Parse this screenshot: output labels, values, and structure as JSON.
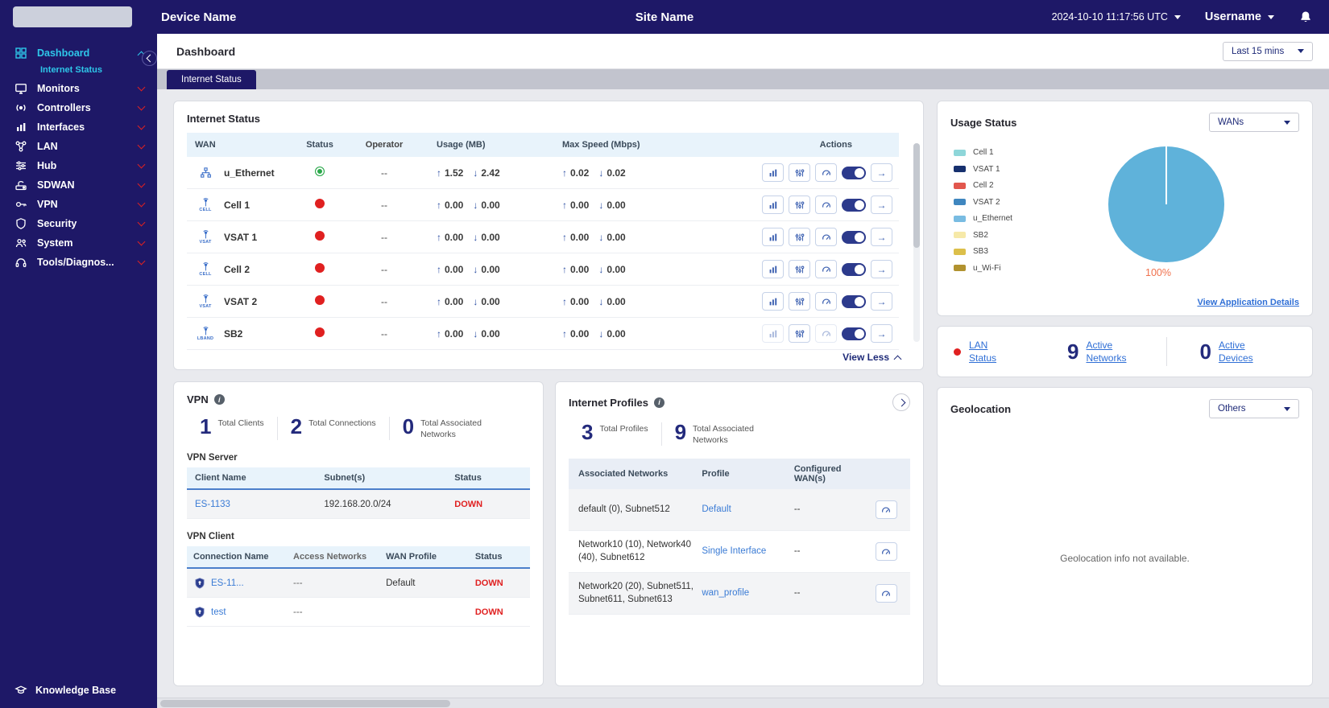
{
  "icons": {
    "up": "↑",
    "down": "↓",
    "info": "i",
    "arrow_right": "→"
  },
  "header": {
    "device_name": "Device Name",
    "site_name": "Site Name",
    "datetime": "2024-10-10 11:17:56 UTC",
    "username": "Username"
  },
  "sidebar": {
    "items": [
      "Dashboard",
      "Internet Status",
      "Monitors",
      "Controllers",
      "Interfaces",
      "LAN",
      "Hub",
      "SDWAN",
      "VPN",
      "Security",
      "System",
      "Tools/Diagnos..."
    ],
    "footer": "Knowledge Base"
  },
  "page": {
    "title": "Dashboard",
    "time_range": "Last 15 mins",
    "tab": "Internet Status"
  },
  "internet_status": {
    "title": "Internet Status",
    "columns": [
      "WAN",
      "Status",
      "Operator",
      "Usage (MB)",
      "Max Speed (Mbps)",
      "Actions"
    ],
    "rows": [
      {
        "name": "u_Ethernet",
        "caption": "",
        "is_ethernet": true,
        "up": true,
        "operator": "--",
        "usage_up": "1.52",
        "usage_down": "2.42",
        "speed_up": "0.02",
        "speed_down": "0.02"
      },
      {
        "name": "Cell 1",
        "caption": "CELL",
        "up": false,
        "operator": "--",
        "usage_up": "0.00",
        "usage_down": "0.00",
        "speed_up": "0.00",
        "speed_down": "0.00"
      },
      {
        "name": "VSAT 1",
        "caption": "VSAT",
        "up": false,
        "operator": "--",
        "usage_up": "0.00",
        "usage_down": "0.00",
        "speed_up": "0.00",
        "speed_down": "0.00"
      },
      {
        "name": "Cell 2",
        "caption": "CELL",
        "up": false,
        "operator": "--",
        "usage_up": "0.00",
        "usage_down": "0.00",
        "speed_up": "0.00",
        "speed_down": "0.00"
      },
      {
        "name": "VSAT 2",
        "caption": "VSAT",
        "up": false,
        "operator": "--",
        "usage_up": "0.00",
        "usage_down": "0.00",
        "speed_up": "0.00",
        "speed_down": "0.00"
      },
      {
        "name": "SB2",
        "caption": "LBAND",
        "up": false,
        "muted": true,
        "operator": "--",
        "usage_up": "0.00",
        "usage_down": "0.00",
        "speed_up": "0.00",
        "speed_down": "0.00"
      }
    ],
    "view_less": "View Less"
  },
  "usage_status": {
    "title": "Usage Status",
    "dropdown": "WANs",
    "legend": [
      {
        "label": "Cell 1",
        "color": "#8ed6d9"
      },
      {
        "label": "VSAT 1",
        "color": "#16306e"
      },
      {
        "label": "Cell 2",
        "color": "#e2574d"
      },
      {
        "label": "VSAT 2",
        "color": "#3f86bf"
      },
      {
        "label": "u_Ethernet",
        "color": "#79bce2"
      },
      {
        "label": "SB2",
        "color": "#f6e9a8"
      },
      {
        "label": "SB3",
        "color": "#dcbf4a"
      },
      {
        "label": "u_Wi-Fi",
        "color": "#b1922f"
      }
    ],
    "pie_color": "#5fb2da",
    "pie_label": "100%",
    "link": "View Application Details"
  },
  "lan_status": {
    "label": "LAN Status",
    "networks": "9",
    "networks_label": "Active Networks",
    "devices": "0",
    "devices_label": "Active Devices"
  },
  "vpn": {
    "title": "VPN",
    "stats": [
      {
        "value": "1",
        "label": "Total Clients"
      },
      {
        "value": "2",
        "label": "Total Connections"
      },
      {
        "value": "0",
        "label": "Total Associated Networks"
      }
    ],
    "server_title": "VPN Server",
    "server_cols": [
      "Client Name",
      "Subnet(s)",
      "Status"
    ],
    "server_rows": [
      {
        "name": "ES-1133",
        "subnets": "192.168.20.0/24",
        "status": "DOWN"
      }
    ],
    "client_title": "VPN Client",
    "client_cols": [
      "Connection Name",
      "Access Networks",
      "WAN Profile",
      "Status"
    ],
    "client_rows": [
      {
        "name": "ES-11...",
        "networks": "---",
        "profile": "Default",
        "status": "DOWN"
      },
      {
        "name": "test",
        "networks": "---",
        "profile": "",
        "status": "DOWN"
      }
    ]
  },
  "internet_profiles": {
    "title": "Internet Profiles",
    "stats": [
      {
        "value": "3",
        "label": "Total Profiles"
      },
      {
        "value": "9",
        "label": "Total Associated Networks"
      }
    ],
    "cols": [
      "Associated Networks",
      "Profile",
      "Configured WAN(s)"
    ],
    "rows": [
      {
        "networks": "default (0), Subnet512",
        "profile": "Default",
        "wans": "--"
      },
      {
        "networks": "Network10 (10), Network40 (40), Subnet612",
        "profile": "Single Interface",
        "wans": "--"
      },
      {
        "networks": "Network20 (20), Subnet511, Subnet611, Subnet613",
        "profile": "wan_profile",
        "wans": "--"
      }
    ]
  },
  "geolocation": {
    "title": "Geolocation",
    "dropdown": "Others",
    "message": "Geolocation info not available."
  }
}
